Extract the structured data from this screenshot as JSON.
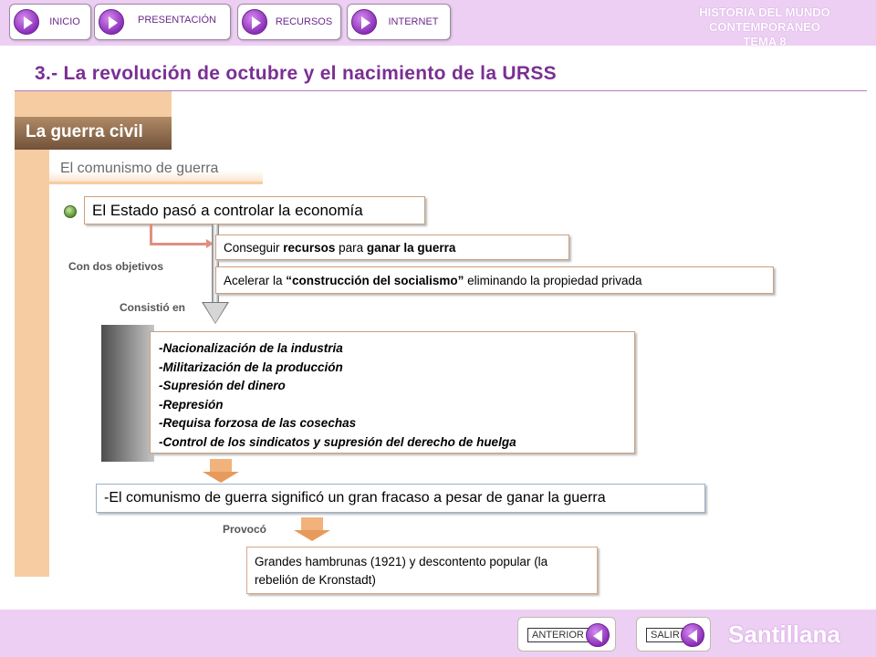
{
  "nav": {
    "items": [
      {
        "label": "INICIO"
      },
      {
        "label": "PRESENTACIÓN"
      },
      {
        "label": "RECURSOS"
      },
      {
        "label": "INTERNET"
      }
    ],
    "header_line1": "HISTORIA DEL MUNDO CONTEMPORÁNEO",
    "header_line2": "TEMA 8"
  },
  "page": {
    "title": "3.- La revolución de octubre y el nacimiento de la URSS",
    "section_tab": "La guerra civil",
    "subtitle": "El comunismo de guerra"
  },
  "diagram": {
    "main": "El Estado pasó a controlar la economía",
    "label_objectives": "Con dos objetivos",
    "objective1": {
      "pre": "Conseguir ",
      "b1": "recursos",
      "mid": " para ",
      "b2": "ganar la guerra"
    },
    "objective2": {
      "pre": "Acelerar la ",
      "b1": "“construcción del socialismo”",
      "post": " eliminando la propiedad privada"
    },
    "label_consisted": "Consistió en",
    "measures": [
      "-Nacionalización de la industria",
      "-Militarización de la producción",
      "-Supresión del dinero",
      "-Represión",
      "-Requisa forzosa de las cosechas",
      "-Control de los sindicatos y supresión del derecho de huelga"
    ],
    "conclusion": "-El comunismo de guerra significó un gran fracaso a pesar de ganar la guerra",
    "label_caused": "Provocó",
    "consequence": "Grandes hambrunas (1921) y descontento popular (la rebelión de Kronstadt)"
  },
  "footer": {
    "prev_label": "ANTERIOR",
    "exit_label": "SALIR",
    "brand": "Santillana"
  },
  "icons": {
    "nav": "play-icon",
    "bullet": "green-bullet-icon",
    "footer": "back-arrow-icon"
  },
  "colors": {
    "banner": "#eecff4",
    "title": "#7a2f93",
    "accent": "#f6cda2",
    "section_tab": "#8a6a4c",
    "arrow": "#f1b27c"
  }
}
